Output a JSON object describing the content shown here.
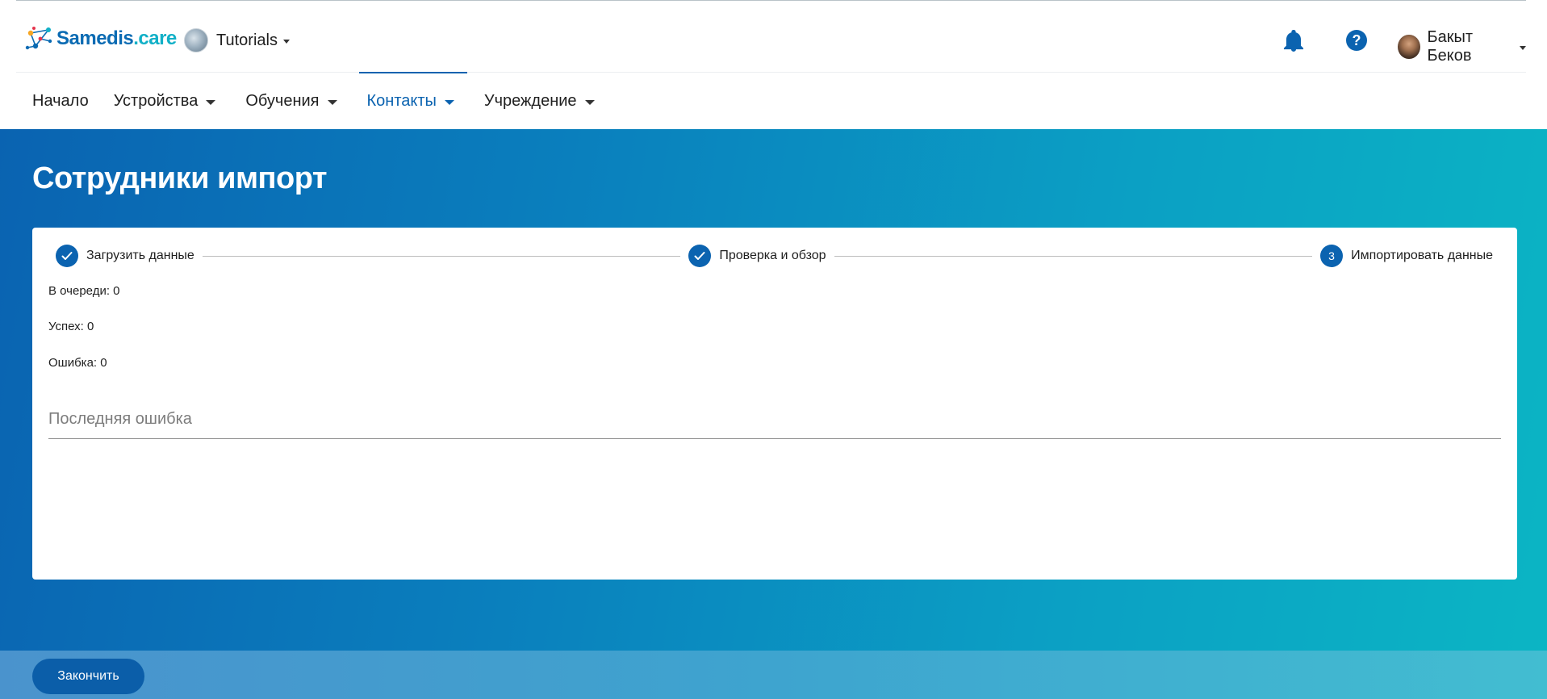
{
  "header": {
    "logo": {
      "part1": "Samedis",
      "part2": ".care"
    },
    "tenant": {
      "label": "Tutorials"
    },
    "icons": {
      "bell": "bell-icon",
      "help": "help-icon",
      "help_glyph": "?"
    },
    "user": {
      "name": "Бакыт Беков"
    }
  },
  "nav": {
    "items": [
      {
        "label": "Начало",
        "dropdown": false,
        "active": false
      },
      {
        "label": "Устройства",
        "dropdown": true,
        "active": false
      },
      {
        "label": "Обучения",
        "dropdown": true,
        "active": false
      },
      {
        "label": "Контакты",
        "dropdown": true,
        "active": true
      },
      {
        "label": "Учреждение",
        "dropdown": true,
        "active": false
      }
    ]
  },
  "page": {
    "title": "Сотрудники импорт"
  },
  "stepper": {
    "steps": [
      {
        "label": "Загрузить данные",
        "state": "completed",
        "icon": "check-icon"
      },
      {
        "label": "Проверка и обзор",
        "state": "completed",
        "icon": "check-icon"
      },
      {
        "label": "Импортировать данные",
        "state": "active",
        "number": "3"
      }
    ]
  },
  "stats": {
    "queued": "В очереди: 0",
    "success": "Успех: 0",
    "error": "Ошибка: 0"
  },
  "last_error": {
    "label": "Последняя ошибка",
    "value": ""
  },
  "footer": {
    "finish_label": "Закончить"
  },
  "colors": {
    "brand_primary": "#0b63b0",
    "brand_secondary": "#11b0c7",
    "hero_gradient_start": "#0a63b1",
    "hero_gradient_end": "#0bb5c4"
  }
}
